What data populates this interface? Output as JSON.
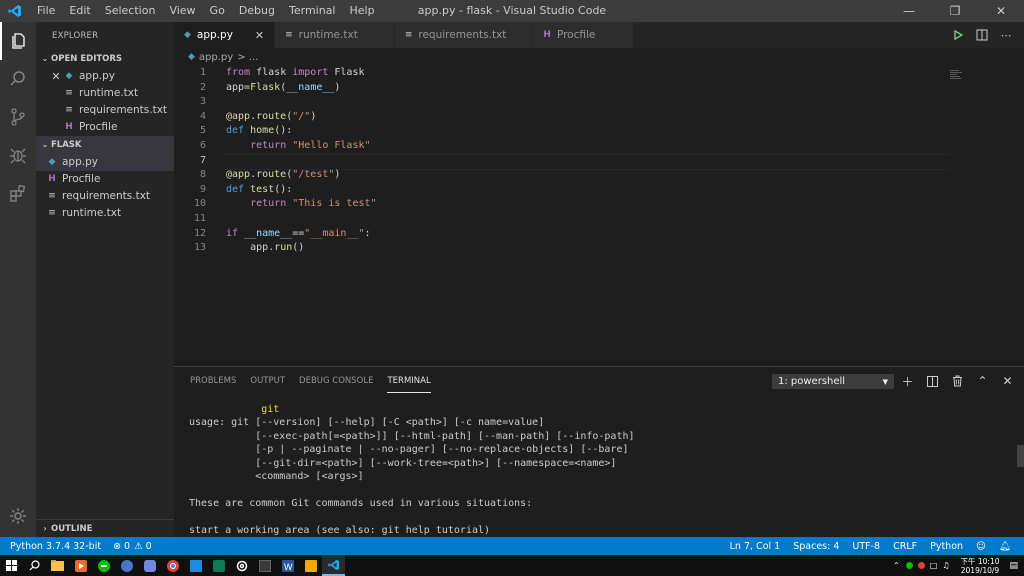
{
  "window": {
    "title": "app.py - flask - Visual Studio Code",
    "menu": [
      "File",
      "Edit",
      "Selection",
      "View",
      "Go",
      "Debug",
      "Terminal",
      "Help"
    ]
  },
  "sidebar": {
    "header": "EXPLORER",
    "open_editors_label": "OPEN EDITORS",
    "open_editors": [
      "app.py",
      "runtime.txt",
      "requirements.txt",
      "Procfile"
    ],
    "folder_label": "FLASK",
    "files": [
      "app.py",
      "Procfile",
      "requirements.txt",
      "runtime.txt"
    ],
    "outline_label": "OUTLINE"
  },
  "tabs": [
    "app.py",
    "runtime.txt",
    "requirements.txt",
    "Procfile"
  ],
  "breadcrumb": {
    "file": "app.py",
    "rest": "> ..."
  },
  "editor": {
    "line_numbers": [
      "1",
      "2",
      "3",
      "4",
      "5",
      "6",
      "7",
      "8",
      "9",
      "10",
      "11",
      "12",
      "13"
    ]
  },
  "panel": {
    "tabs": [
      "PROBLEMS",
      "OUTPUT",
      "DEBUG CONSOLE",
      "TERMINAL"
    ],
    "terminal_select": "1: powershell",
    "terminal_lines": [
      "            git",
      "usage: git [--version] [--help] [-C <path>] [-c name=value]",
      "           [--exec-path[=<path>]] [--html-path] [--man-path] [--info-path]",
      "           [-p | --paginate | --no-pager] [--no-replace-objects] [--bare]",
      "           [--git-dir=<path>] [--work-tree=<path>] [--namespace=<name>]",
      "           <command> [<args>]",
      "",
      "These are common Git commands used in various situations:",
      "",
      "start a working area (see also: git help tutorial)"
    ]
  },
  "statusbar": {
    "interpreter": "Python 3.7.4 32-bit",
    "errors": "0",
    "warnings": "0",
    "position": "Ln 7, Col 1",
    "spaces": "Spaces: 4",
    "encoding": "UTF-8",
    "eol": "CRLF",
    "language": "Python"
  },
  "taskbar": {
    "time": "下午 10:10",
    "date": "2019/10/9"
  },
  "colors": {
    "accent": "#007acc",
    "keyword": "#c586c0",
    "function": "#dcdcaa",
    "string": "#ce9178",
    "python_icon": "#519aba"
  }
}
